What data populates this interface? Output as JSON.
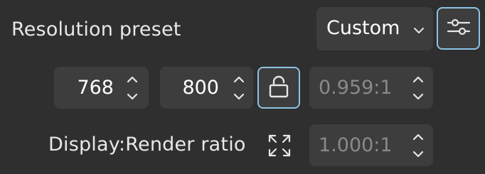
{
  "resolution": {
    "label": "Resolution preset",
    "preset_value": "Custom",
    "preset_icon": "chevron-down-icon",
    "settings_icon": "sliders-icon"
  },
  "dimensions": {
    "width_value": "768",
    "height_value": "800",
    "lock_icon": "unlocked-padlock-icon",
    "aspect_value": "0.959:1"
  },
  "display_ratio": {
    "label": "Display:Render ratio",
    "icon": "expand-arrows-icon",
    "value": "1.000:1"
  },
  "colors": {
    "background": "#2f2f2f",
    "field": "#3d3d3d",
    "accent_border": "#8cc3e6",
    "text": "#e8e8e8",
    "disabled_text": "#8a8a8a"
  }
}
